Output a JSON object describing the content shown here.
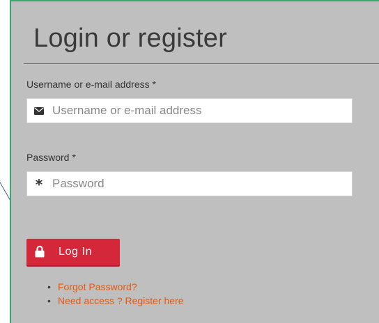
{
  "form": {
    "title": "Login or register",
    "username": {
      "label": "Username or e-mail address *",
      "placeholder": "Username or e-mail address",
      "value": "",
      "icon": "envelope-icon"
    },
    "password": {
      "label": "Password *",
      "placeholder": "Password",
      "value": "",
      "icon": "asterisk-icon",
      "icon_glyph": "*"
    },
    "login_button": {
      "label": "Log In",
      "icon": "lock-icon"
    },
    "links": [
      {
        "label": "Forgot Password?"
      },
      {
        "label": "Need access ? Register here"
      }
    ],
    "bullet": "•"
  },
  "colors": {
    "panel_background": "#bfbfbf",
    "panel_border": "#3aa870",
    "button_background": "#d4283a",
    "link": "#e05a12",
    "connector_line": "#3a5fa0"
  }
}
